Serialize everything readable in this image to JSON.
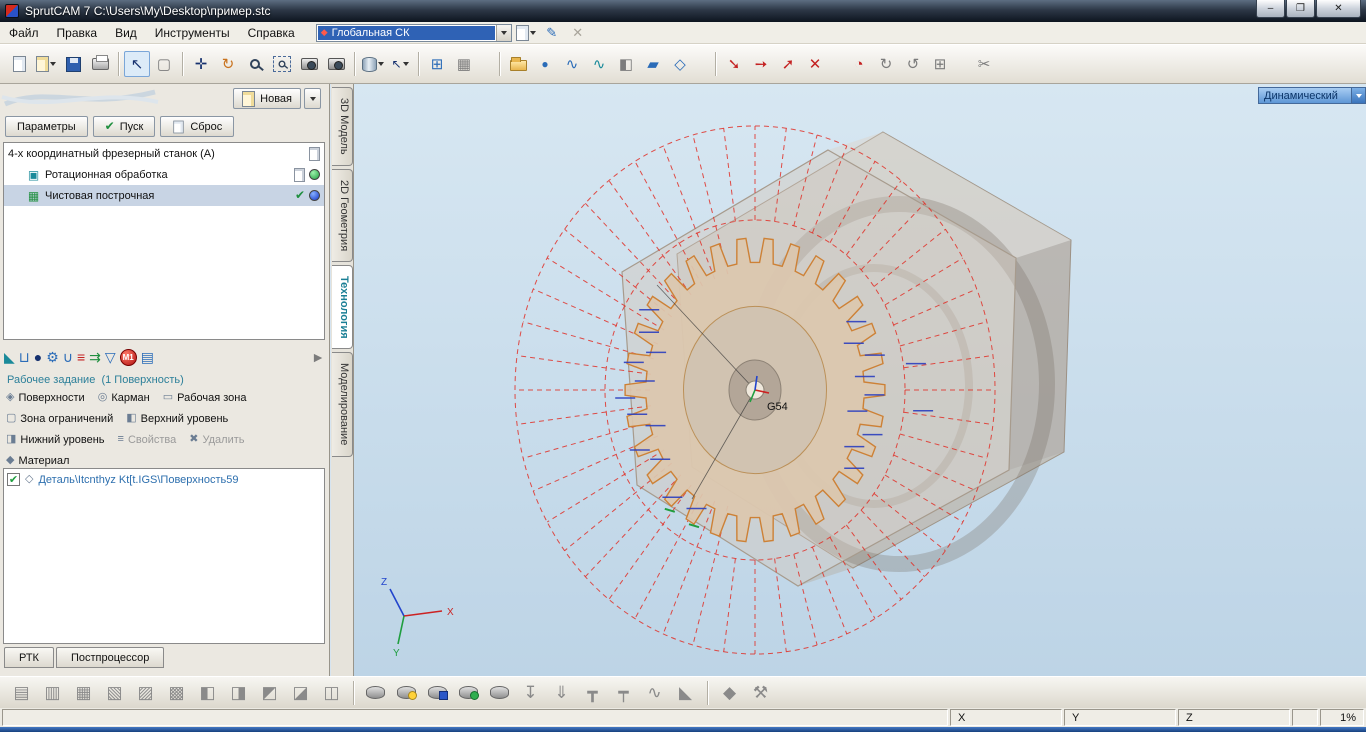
{
  "window": {
    "title": "SprutCAM 7   C:\\Users\\My\\Desktop\\пример.stc"
  },
  "menu": {
    "items": [
      "Файл",
      "Правка",
      "Вид",
      "Инструменты",
      "Справка"
    ],
    "cs_value": "Глобальная СК"
  },
  "panel": {
    "new_button": "Новая",
    "params_button": "Параметры",
    "run_button": "Пуск",
    "reset_button": "Сброс",
    "tree": {
      "machine": "4-х координатный фрезерный станок (A)",
      "operation_group": "Ротационная обработка",
      "operation": "Чистовая построчная"
    },
    "job_title": "Рабочее задание",
    "job_count": "(1 Поверхность)",
    "links": {
      "surfaces": "Поверхности",
      "pocket": "Карман",
      "work_zone": "Рабочая зона",
      "restrict_zone": "Зона ограничений",
      "top_level": "Верхний уровень",
      "bottom_level": "Нижний уровень",
      "properties": "Свойства",
      "delete": "Удалить",
      "material": "Материал"
    },
    "job_list_item": "Деталь\\Itcnthyz Kt[t.IGS\\Поверхность59",
    "bottom_tabs": [
      "РТК",
      "Постпроцессор"
    ]
  },
  "side_tabs": [
    "3D Модель",
    "2D Геометрия",
    "Технология",
    "Моделирование"
  ],
  "viewport": {
    "mode": "Динамический",
    "origin": "G54",
    "axis_x": "X",
    "axis_y": "Y",
    "axis_z": "Z"
  },
  "status": {
    "x": "X",
    "y": "Y",
    "z": "Z",
    "zoom": "1%"
  },
  "icons": {
    "win_min": "–",
    "win_max": "❐",
    "win_close": "✕",
    "cs_marker": "◆",
    "cs_edit": "✎",
    "cs_close": "✕",
    "tb_select": "↖",
    "tb_box_select": "▢",
    "tb_pan": "✛",
    "tb_rotate": "↻",
    "tb_pick": "↖",
    "tb_coord": "⊞",
    "tb_calc": "▦",
    "tb_point": "●",
    "tb_curve": "∿",
    "tb_curve2": "∿",
    "tb_surface": "◧",
    "tb_plane": "▰",
    "tb_face": "◇",
    "tb_snap_end": "➘",
    "tb_snap_mid": "➙",
    "tb_snap_int": "➚",
    "tb_snap_off": "✕",
    "tb_meas": "◔",
    "tb_rot_cw": "↻",
    "tb_rot_ccw": "↺",
    "tb_array": "⊞",
    "tb_cut": "✂",
    "run_check": "✔",
    "tree_rot": "▣",
    "tree_fin": "▦",
    "tree_check": "✔",
    "strip_job": "◣",
    "strip_vice": "⊔",
    "strip_ball": "●",
    "strip_gears": "⚙",
    "strip_magnet": "∪",
    "strip_feeds": "≡",
    "strip_strategy": "⇉",
    "strip_filter": "▽",
    "strip_post": "▤",
    "strip_more": "►",
    "m1": "M1",
    "link_surfaces": "◈",
    "link_pocket": "◎",
    "link_zone": "▭",
    "link_restrict": "▢",
    "link_top": "◧",
    "link_bottom": "◨",
    "link_props": "≡",
    "link_delete": "✖",
    "link_material": "◆",
    "list_check": "✔",
    "list_diamond": "◇",
    "bm1": "▤",
    "bm2": "▥",
    "bm3": "▦",
    "bm4": "▧",
    "bm5": "▨",
    "bm6": "▩",
    "bm7": "◧",
    "bm8": "◨",
    "bm9": "◩",
    "bm10": "◪",
    "bm11": "◫",
    "sim_arrow1": "↧",
    "sim_arrow2": "⇓",
    "sim_drill1": "┳",
    "sim_drill2": "┯",
    "sim_path": "∿",
    "sim_part": "◣",
    "sim_run": "◆",
    "wrench": "⚒"
  }
}
